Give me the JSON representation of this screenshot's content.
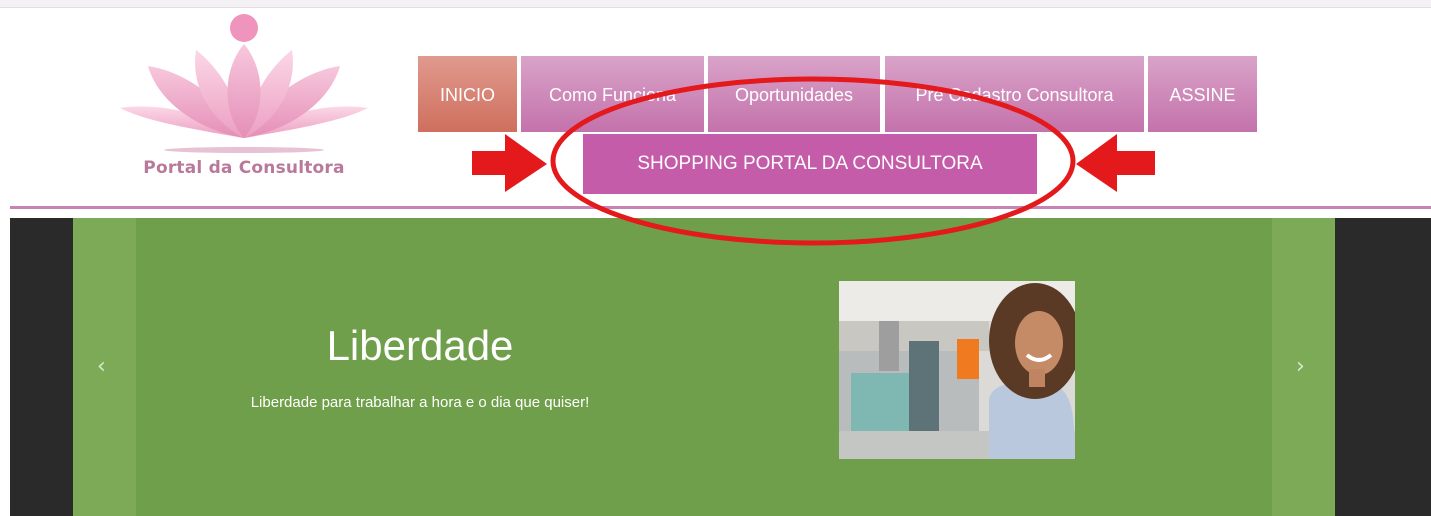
{
  "header": {
    "logo_text": "Portal da Consultora",
    "nav": [
      {
        "label": "INICIO",
        "active": true
      },
      {
        "label": "Como Funciona",
        "active": false
      },
      {
        "label": "Oportunidades",
        "active": false
      },
      {
        "label": "Pré Cadastro Consultora",
        "active": false
      },
      {
        "label": "ASSINE",
        "active": false
      }
    ],
    "shopping_label": "SHOPPING PORTAL DA CONSULTORA"
  },
  "slider": {
    "title": "Liberdade",
    "subtitle": "Liberdade para trabalhar a hora e o dia que quiser!",
    "prev_icon": "chevron-left-icon",
    "next_icon": "chevron-right-icon"
  },
  "colors": {
    "nav_pink": "#c472ab",
    "nav_active": "#cf6f5e",
    "shopping_button": "#c45ca9",
    "slide_green": "#6f9f4a",
    "annotation_red": "#e3191b"
  }
}
